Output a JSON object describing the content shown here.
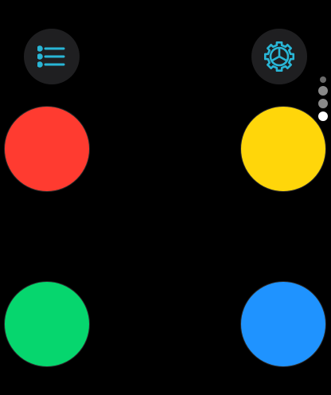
{
  "toolbar": {
    "menu_icon": "list-icon",
    "settings_icon": "gear-icon",
    "icon_color": "#29b6d6",
    "button_bg": "#1f1f21"
  },
  "colors": {
    "top_left": "#ff3b30",
    "top_right": "#ffd60a",
    "bottom_left": "#06d66e",
    "bottom_right": "#1f93ff"
  },
  "page_indicator": {
    "total": 4,
    "current": 4,
    "colors": [
      "#6a6a6a",
      "#8a8a8a",
      "#8a8a8a",
      "#ffffff"
    ]
  }
}
